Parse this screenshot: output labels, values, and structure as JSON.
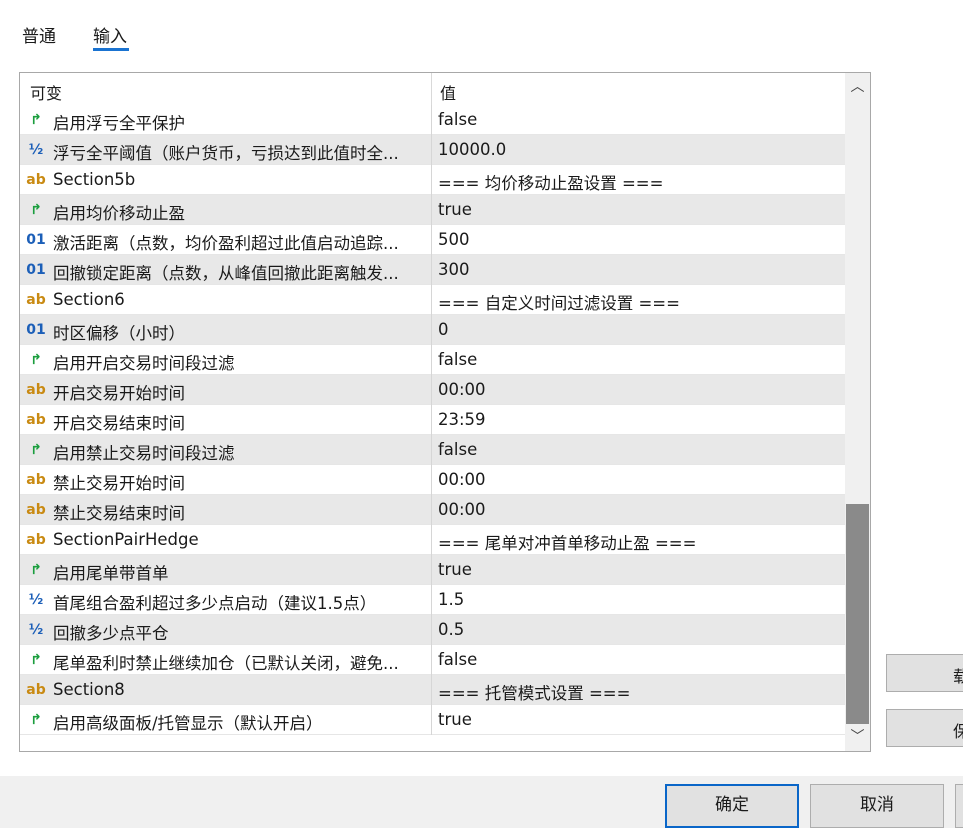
{
  "tabs": [
    {
      "label": "普通"
    },
    {
      "label": "输入"
    }
  ],
  "grid": {
    "header": {
      "name": "可变",
      "value": "值"
    },
    "rows": [
      {
        "icon": "bool-icon",
        "glyph": "↱",
        "name": "启用浮亏全平保护",
        "value": "false"
      },
      {
        "icon": "double-icon",
        "glyph": "½",
        "name": "浮亏全平阈值（账户货币，亏损达到此值时全...",
        "value": "10000.0"
      },
      {
        "icon": "string-icon",
        "glyph": "ab",
        "name": "Section5b",
        "value": "=== 均价移动止盈设置 ==="
      },
      {
        "icon": "bool-icon",
        "glyph": "↱",
        "name": "启用均价移动止盈",
        "value": "true"
      },
      {
        "icon": "int-icon",
        "glyph": "01",
        "name": "激活距离（点数，均价盈利超过此值启动追踪...",
        "value": "500"
      },
      {
        "icon": "int-icon",
        "glyph": "01",
        "name": "回撤锁定距离（点数，从峰值回撤此距离触发...",
        "value": "300"
      },
      {
        "icon": "string-icon",
        "glyph": "ab",
        "name": "Section6",
        "value": "=== 自定义时间过滤设置 ==="
      },
      {
        "icon": "int-icon",
        "glyph": "01",
        "name": "时区偏移（小时）",
        "value": "0"
      },
      {
        "icon": "bool-icon",
        "glyph": "↱",
        "name": "启用开启交易时间段过滤",
        "value": "false"
      },
      {
        "icon": "string-icon",
        "glyph": "ab",
        "name": "开启交易开始时间",
        "value": "00:00"
      },
      {
        "icon": "string-icon",
        "glyph": "ab",
        "name": "开启交易结束时间",
        "value": "23:59"
      },
      {
        "icon": "bool-icon",
        "glyph": "↱",
        "name": "启用禁止交易时间段过滤",
        "value": "false"
      },
      {
        "icon": "string-icon",
        "glyph": "ab",
        "name": "禁止交易开始时间",
        "value": "00:00"
      },
      {
        "icon": "string-icon",
        "glyph": "ab",
        "name": "禁止交易结束时间",
        "value": "00:00"
      },
      {
        "icon": "string-icon",
        "glyph": "ab",
        "name": "SectionPairHedge",
        "value": "=== 尾单对冲首单移动止盈 ==="
      },
      {
        "icon": "bool-icon",
        "glyph": "↱",
        "name": "启用尾单带首单",
        "value": "true"
      },
      {
        "icon": "double-icon",
        "glyph": "½",
        "name": "首尾组合盈利超过多少点启动（建议1.5点）",
        "value": "1.5"
      },
      {
        "icon": "double-icon",
        "glyph": "½",
        "name": "回撤多少点平仓",
        "value": "0.5"
      },
      {
        "icon": "bool-icon",
        "glyph": "↱",
        "name": "尾单盈利时禁止继续加仓（已默认关闭，避免...",
        "value": "false"
      },
      {
        "icon": "string-icon",
        "glyph": "ab",
        "name": "Section8",
        "value": "=== 托管模式设置 ==="
      },
      {
        "icon": "bool-icon",
        "glyph": "↱",
        "name": "启用高级面板/托管显示（默认开启）",
        "value": "true"
      }
    ]
  },
  "side_buttons": [
    "载",
    "保"
  ],
  "buttons": {
    "ok": "确定",
    "cancel": "取消"
  }
}
